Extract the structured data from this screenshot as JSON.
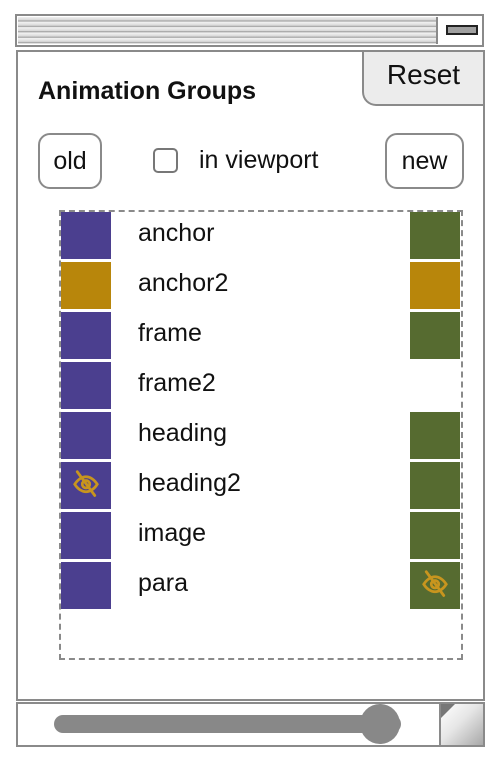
{
  "window": {
    "minimize_icon": "minimize-icon"
  },
  "panel": {
    "title": "Animation Groups",
    "reset_label": "Reset",
    "old_label": "old",
    "new_label": "new",
    "in_viewport": {
      "label": "in viewport",
      "checked": false
    }
  },
  "colors": {
    "old": "#4b3f8f",
    "new": "#566b30",
    "changed": "#b8860b",
    "icon": "#c8951e"
  },
  "groups": [
    {
      "name": "anchor",
      "old": "old",
      "new": "new",
      "old_hidden": false,
      "new_hidden": false
    },
    {
      "name": "anchor2",
      "old": "changed",
      "new": "changed",
      "old_hidden": false,
      "new_hidden": false
    },
    {
      "name": "frame",
      "old": "old",
      "new": "new",
      "old_hidden": false,
      "new_hidden": false
    },
    {
      "name": "frame2",
      "old": "old",
      "new": null,
      "old_hidden": false,
      "new_hidden": false
    },
    {
      "name": "heading",
      "old": "old",
      "new": "new",
      "old_hidden": false,
      "new_hidden": false
    },
    {
      "name": "heading2",
      "old": "old",
      "new": "new",
      "old_hidden": true,
      "new_hidden": false
    },
    {
      "name": "image",
      "old": "old",
      "new": "new",
      "old_hidden": false,
      "new_hidden": false
    },
    {
      "name": "para",
      "old": "old",
      "new": "new",
      "old_hidden": false,
      "new_hidden": true
    }
  ],
  "slider": {
    "value_fraction": 0.94
  },
  "icons": {
    "hidden": "eye-slash-icon",
    "resize": "resize-handle-icon"
  }
}
